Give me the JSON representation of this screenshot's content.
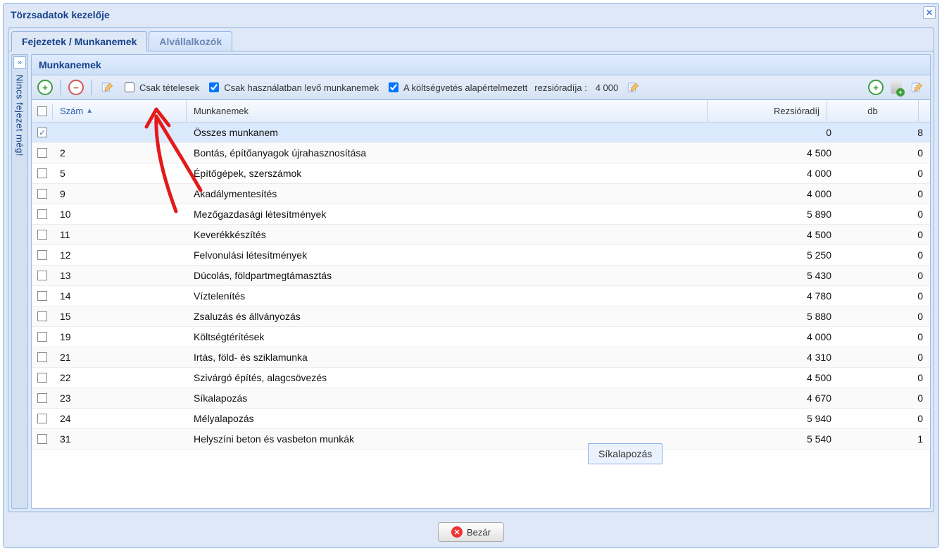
{
  "window": {
    "title": "Törzsadatok kezelője"
  },
  "tabs": [
    {
      "label": "Fejezetek / Munkanemek",
      "active": true
    },
    {
      "label": "Alvállalkozók",
      "active": false
    }
  ],
  "side_rail": {
    "collapsed_label": "Nincs fejezet még!"
  },
  "panel": {
    "title": "Munkanemek"
  },
  "toolbar": {
    "chk_csak_tetelesek_label": "Csak tételesek",
    "chk_csak_hasznalatban_label": "Csak használatban levő munkanemek",
    "chk_koltsegvetes_label": "A költségvetés alapértelmezett",
    "rezsi_label": "rezsióradíja :",
    "rezsi_value": "4 000"
  },
  "columns": {
    "szam": "Szám",
    "munkanemek": "Munkanemek",
    "rezsioradij": "Rezsióradíj",
    "db": "db"
  },
  "rows": [
    {
      "checked": true,
      "szam": "",
      "name": "Összes munkanem",
      "rez": "0",
      "db": "8"
    },
    {
      "checked": false,
      "szam": "2",
      "name": "Bontás, építőanyagok újrahasznosítása",
      "rez": "4 500",
      "db": "0"
    },
    {
      "checked": false,
      "szam": "5",
      "name": "Építőgépek, szerszámok",
      "rez": "4 000",
      "db": "0"
    },
    {
      "checked": false,
      "szam": "9",
      "name": "Akadálymentesítés",
      "rez": "4 000",
      "db": "0"
    },
    {
      "checked": false,
      "szam": "10",
      "name": "Mezőgazdasági létesítmények",
      "rez": "5 890",
      "db": "0"
    },
    {
      "checked": false,
      "szam": "11",
      "name": "Keverékkészítés",
      "rez": "4 500",
      "db": "0"
    },
    {
      "checked": false,
      "szam": "12",
      "name": "Felvonulási létesítmények",
      "rez": "5 250",
      "db": "0"
    },
    {
      "checked": false,
      "szam": "13",
      "name": "Dúcolás, földpartmegtámasztás",
      "rez": "5 430",
      "db": "0"
    },
    {
      "checked": false,
      "szam": "14",
      "name": "Víztelenítés",
      "rez": "4 780",
      "db": "0"
    },
    {
      "checked": false,
      "szam": "15",
      "name": "Zsaluzás és állványozás",
      "rez": "5 880",
      "db": "0"
    },
    {
      "checked": false,
      "szam": "19",
      "name": "Költségtérítések",
      "rez": "4 000",
      "db": "0"
    },
    {
      "checked": false,
      "szam": "21",
      "name": "Irtás, föld- és sziklamunka",
      "rez": "4 310",
      "db": "0"
    },
    {
      "checked": false,
      "szam": "22",
      "name": "Szivárgó építés, alagcsövezés",
      "rez": "4 500",
      "db": "0"
    },
    {
      "checked": false,
      "szam": "23",
      "name": "Síkalapozás",
      "rez": "4 670",
      "db": "0"
    },
    {
      "checked": false,
      "szam": "24",
      "name": "Mélyalapozás",
      "rez": "5 940",
      "db": "0"
    },
    {
      "checked": false,
      "szam": "31",
      "name": "Helyszíni beton és vasbeton munkák",
      "rez": "5 540",
      "db": "1"
    }
  ],
  "tooltip": {
    "text": "Síkalapozás"
  },
  "footer": {
    "close_label": "Bezár"
  }
}
